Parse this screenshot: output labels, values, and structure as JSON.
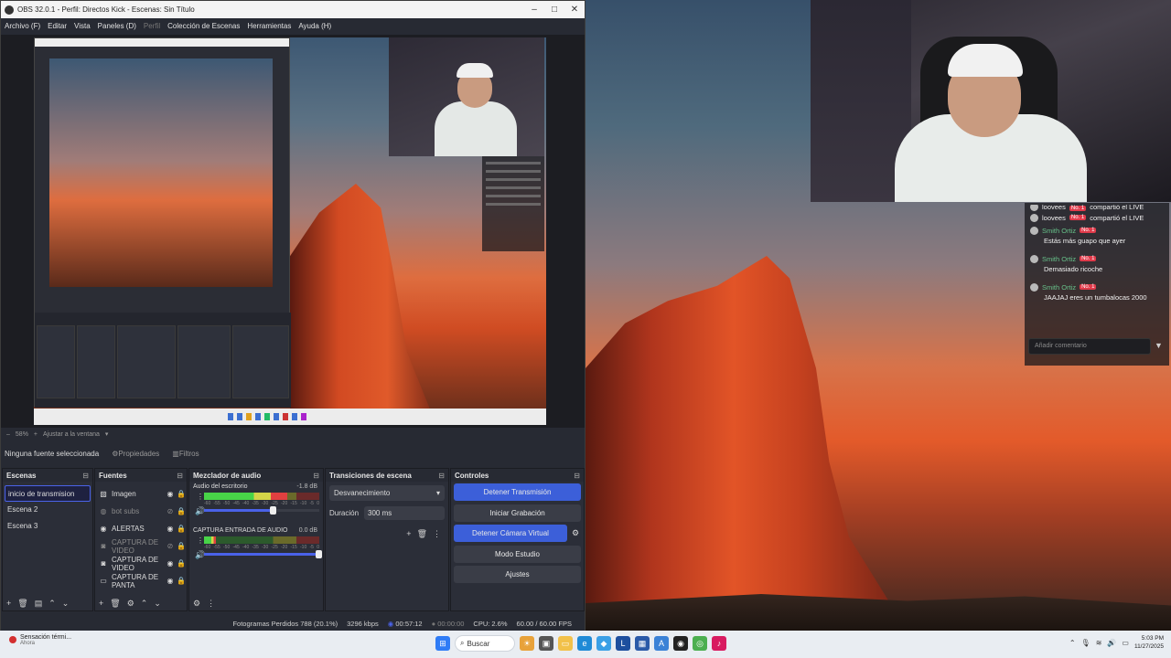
{
  "window": {
    "title": "OBS 32.0.1 - Perfil: Directos Kick - Escenas: Sin Título",
    "menu": [
      {
        "label": "Archivo (F)",
        "disabled": false
      },
      {
        "label": "Editar",
        "disabled": false
      },
      {
        "label": "Vista",
        "disabled": false
      },
      {
        "label": "Paneles (D)",
        "disabled": false
      },
      {
        "label": "Perfil",
        "disabled": true
      },
      {
        "label": "Colección de Escenas",
        "disabled": false
      },
      {
        "label": "Herramientas",
        "disabled": false
      },
      {
        "label": "Ayuda (H)",
        "disabled": false
      }
    ]
  },
  "preview": {
    "zoom": "58%",
    "fit_label": "Ajustar a la ventana"
  },
  "source_toolbar": {
    "no_source": "Ninguna fuente seleccionada",
    "properties": "Propiedades",
    "filters": "Filtros"
  },
  "docks": {
    "scenes": {
      "title": "Escenas",
      "items": [
        {
          "label": "inicio de transmision",
          "selected": true
        },
        {
          "label": "Escena 2",
          "selected": false
        },
        {
          "label": "Escena 3",
          "selected": false
        }
      ]
    },
    "sources": {
      "title": "Fuentes",
      "items": [
        {
          "label": "Imagen",
          "icon": "image-icon",
          "dim": false
        },
        {
          "label": "bot subs",
          "icon": "browser-icon",
          "dim": true
        },
        {
          "label": "ALERTAS",
          "icon": "globe-icon",
          "dim": false
        },
        {
          "label": "CAPTURA DE VIDEO",
          "icon": "camera-icon",
          "dim": true
        },
        {
          "label": "CAPTURA DE VIDEO",
          "icon": "camera-icon",
          "dim": false
        },
        {
          "label": "CAPTURA DE PANTA",
          "icon": "display-icon",
          "dim": false
        }
      ]
    },
    "mixer": {
      "title": "Mezclador de audio",
      "channels": [
        {
          "name": "Audio del escritorio",
          "db": "-1.8 dB",
          "level": 0.72,
          "volume": 0.6
        },
        {
          "name": "CAPTURA ENTRADA DE AUDIO",
          "db": "0.0 dB",
          "level": 0.1,
          "volume": 1.0
        }
      ],
      "ticks": [
        "-60",
        "-55",
        "-50",
        "-45",
        "-40",
        "-35",
        "-30",
        "-25",
        "-20",
        "-15",
        "-10",
        "-5",
        "0"
      ]
    },
    "transitions": {
      "title": "Transiciones de escena",
      "selected": "Desvanecimiento",
      "duration_label": "Duración",
      "duration_value": "300 ms"
    },
    "controls": {
      "title": "Controles",
      "stop_stream": "Detener Transmisión",
      "start_recording": "Iniciar Grabación",
      "stop_virtualcam": "Detener Cámara Virtual",
      "studio_mode": "Modo Estudio",
      "settings": "Ajustes"
    }
  },
  "status": {
    "dropped": "Fotogramas Perdidos 788 (20.1%)",
    "bitrate": "3296 kbps",
    "stream_time": "00:57:12",
    "rec_time": "00:00:00",
    "cpu": "CPU: 2.6%",
    "fps": "60.00 / 60.00 FPS"
  },
  "chat": {
    "messages": [
      {
        "user": "loovees",
        "badge": "No. 1",
        "text": "compartió el LIVE",
        "inline": true,
        "clipped": true
      },
      {
        "user": "loovees",
        "badge": "No. 1",
        "text": "compartió el LIVE",
        "inline": true,
        "clipped": false
      },
      {
        "user": "Smith Ortiz",
        "badge": "No. 1",
        "text": "Estás más guapo que ayer",
        "inline": false
      },
      {
        "user": "Smith Ortiz",
        "badge": "No. 1",
        "text": "Demasiado ricoche",
        "inline": false
      },
      {
        "user": "Smith Ortiz",
        "badge": "No. 1",
        "text": "JAAJAJ eres un tumbalocas 2000",
        "inline": false
      }
    ],
    "input_placeholder": "Añadir comentario"
  },
  "taskbar": {
    "notification_title": "Sensación térmi...",
    "notification_sub": "Ahora",
    "search_label": "Buscar",
    "time": "5:03 PM",
    "date": "11/27/2025"
  }
}
